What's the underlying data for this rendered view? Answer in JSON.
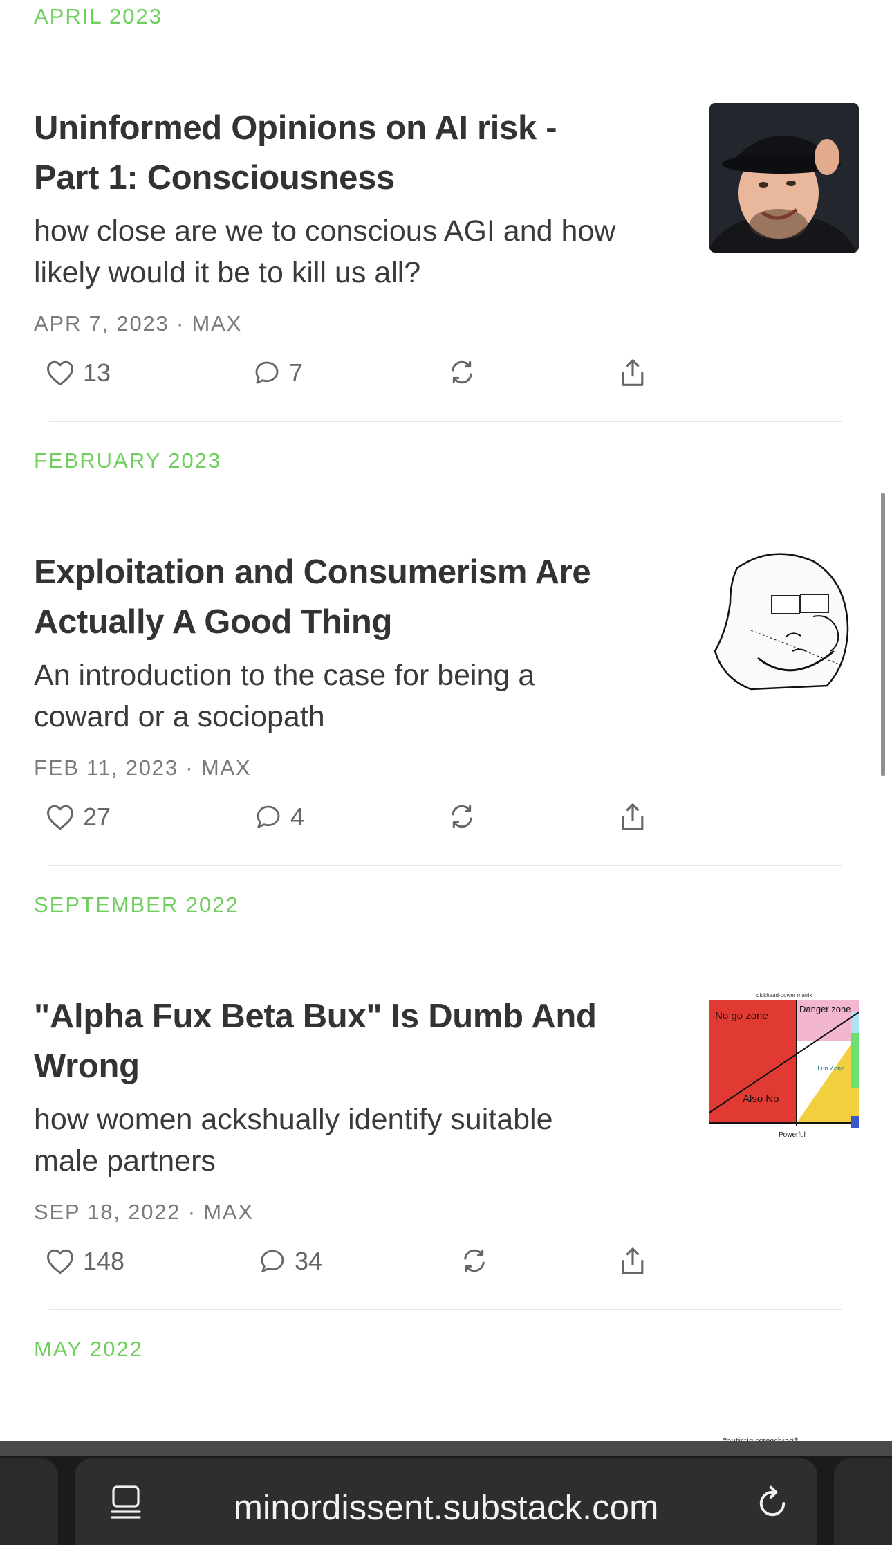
{
  "sections": [
    {
      "month": "APRIL 2023",
      "post": {
        "title_lines": [
          "Uninformed Opinions on AI risk -",
          "Part 1: Consciousness"
        ],
        "subtitle_lines": [
          "how close are we to conscious AGI and how",
          "likely would it be to kill us all?"
        ],
        "meta": "APR 7, 2023 · MAX",
        "likes": "13",
        "comments": "7",
        "thumbnail": "man-in-fedora-photo"
      }
    },
    {
      "month": "FEBRUARY 2023",
      "post": {
        "title_lines": [
          "Exploitation and Consumerism Are",
          "Actually A Good Thing"
        ],
        "subtitle_lines": [
          "An introduction to the case for being a",
          "coward or a sociopath"
        ],
        "meta": "FEB 11, 2023 · MAX",
        "likes": "27",
        "comments": "4",
        "thumbnail": "wojak-sketch"
      }
    },
    {
      "month": "SEPTEMBER 2022",
      "post": {
        "title_lines": [
          "\"Alpha Fux Beta Bux\" Is Dumb And",
          "Wrong"
        ],
        "subtitle_lines": [
          "how women ackshually identify suitable",
          "male partners"
        ],
        "meta": "SEP 18, 2022 · MAX",
        "likes": "148",
        "comments": "34",
        "thumbnail": "power-matrix-chart",
        "thumbnail_text": {
          "heading": "dickhead-power matrix",
          "zone_1": "No go zone",
          "zone_2": "Danger zone",
          "zone_3": "Fun Zone",
          "zone_4": "Also No",
          "axis": "Powerful"
        }
      }
    },
    {
      "month": "MAY 2022"
    }
  ],
  "peek_text": "*autistic screeching*",
  "browser": {
    "url": "minordissent.substack.com",
    "left_icon": "reader-icon",
    "right_icon": "reload-icon"
  },
  "colors": {
    "accent_green": "#6fcf5c",
    "title": "#333333",
    "meta": "#7a7a7a",
    "toolbar_bg": "#1b1b1b"
  }
}
